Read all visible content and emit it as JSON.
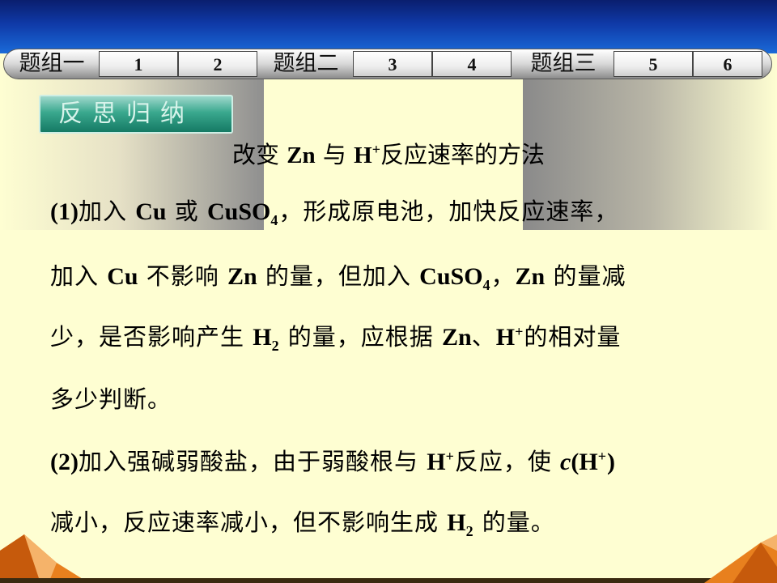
{
  "nav": {
    "groups": [
      "题组一",
      "题组二",
      "题组三"
    ],
    "numbers": [
      "1",
      "2",
      "3",
      "4",
      "5",
      "6"
    ]
  },
  "badge": "反思归纳",
  "title": {
    "pre": "改变 ",
    "zn": "Zn",
    "mid": " 与 ",
    "h": "H",
    "plus": "+",
    "post": "反应速率的方法"
  },
  "lines": {
    "l1": {
      "t1": "(1)",
      "t2": "加入 ",
      "t3": "Cu",
      "t4": " 或 ",
      "t5": "CuSO",
      "t6": "4",
      "t7": "，形成原电池，加快反应速率，"
    },
    "l2": {
      "t1": "加入 ",
      "t2": "Cu",
      "t3": " 不影响 ",
      "t4": "Zn",
      "t5": " 的量，但加入 ",
      "t6": "CuSO",
      "t7": "4",
      "t8": "，",
      "t9": "Zn",
      "t10": " 的量减"
    },
    "l3": {
      "t1": "少，是否影响产生 ",
      "t2": "H",
      "t3": "2",
      "t4": " 的量，应根据 ",
      "t5": "Zn",
      "t6": "、",
      "t7": "H",
      "t8": "+",
      "t9": "的相对量"
    },
    "l4": {
      "t1": "多少判断。"
    },
    "l5": {
      "t1": "(2)",
      "t2": "加入强碱弱酸盐，由于弱酸根与 ",
      "t3": "H",
      "t4": "+",
      "t5": "反应，使 ",
      "t6": "c",
      "t7": "(H",
      "t8": "+",
      "t9": ")"
    },
    "l6": {
      "t1": "减小，反应速率减小，但不影响生成 ",
      "t2": "H",
      "t3": "2",
      "t4": " 的量。"
    }
  },
  "colors": {
    "background": "#fefed2",
    "top_band": "#0f3aa8",
    "badge": "#3aa88e",
    "accent_orange": "#e8801e"
  }
}
